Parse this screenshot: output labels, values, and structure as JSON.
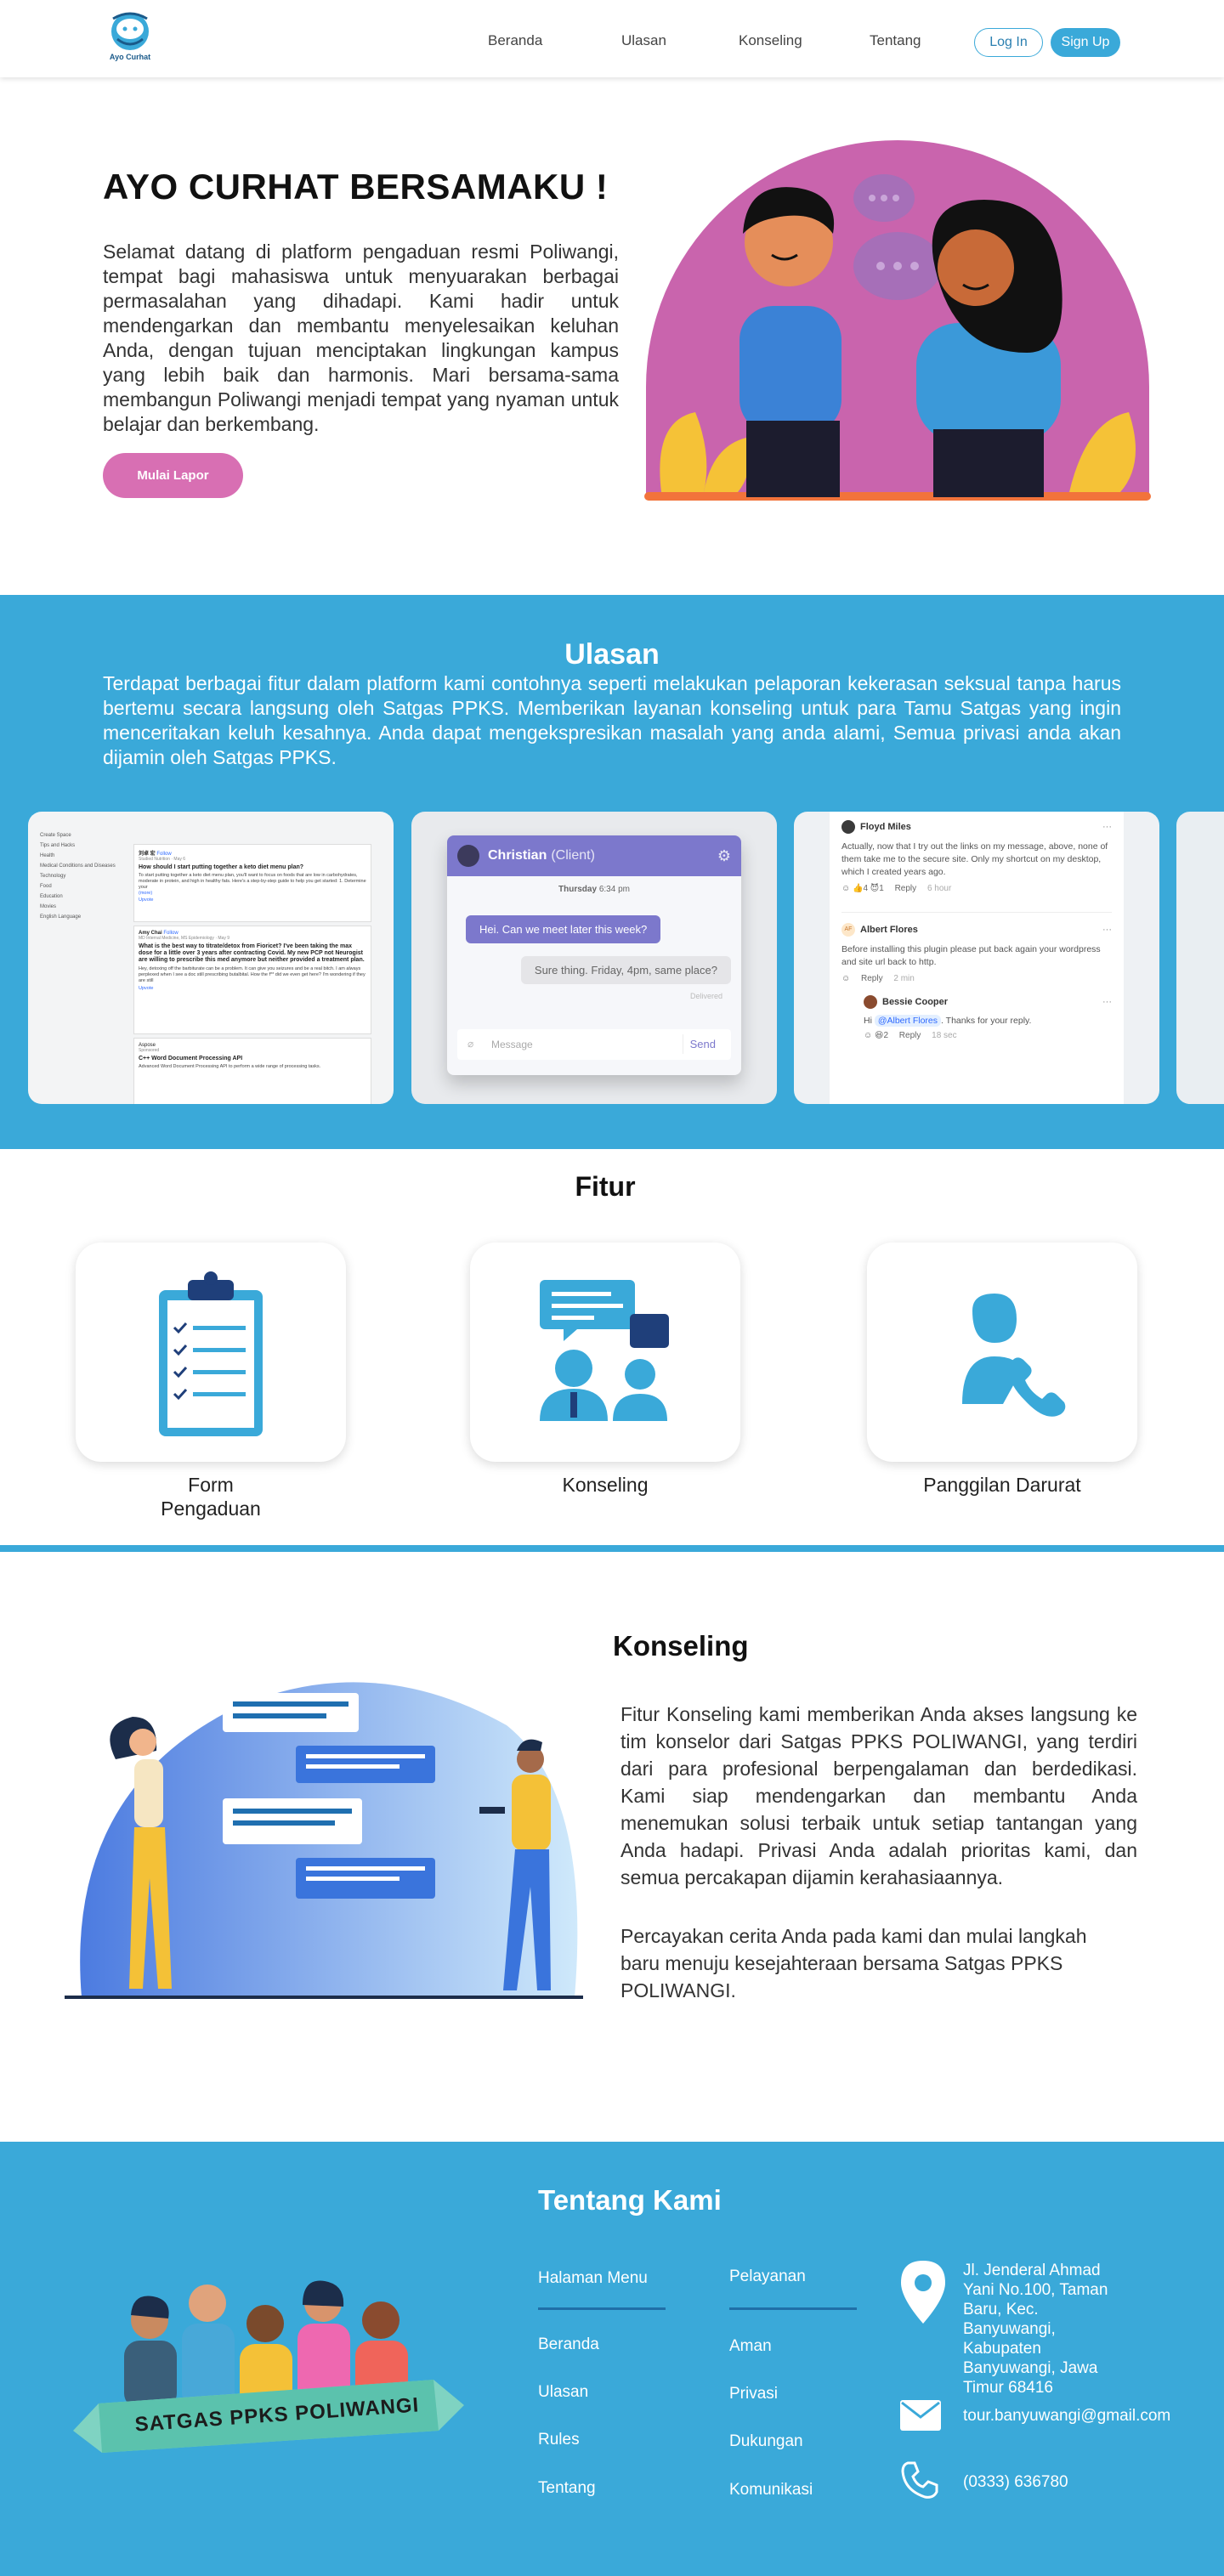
{
  "nav": {
    "logo_text": "Ayo Curhat",
    "links": [
      "Beranda",
      "Ulasan",
      "Konseling",
      "Tentang"
    ],
    "login": "Log In",
    "signup": "Sign Up"
  },
  "hero": {
    "title": "AYO CURHAT BERSAMAKU !",
    "text": "Selamat datang di platform pengaduan resmi Poliwangi, tempat bagi mahasiswa untuk menyuarakan berbagai permasalahan yang dihadapi. Kami hadir untuk mendengarkan dan membantu menyelesaikan keluhan Anda, dengan tujuan menciptakan lingkungan kampus yang lebih baik dan harmonis. Mari bersama-sama membangun Poliwangi menjadi tempat yang nyaman untuk belajar dan berkembang.",
    "button": "Mulai Lapor"
  },
  "ulasan": {
    "title": "Ulasan",
    "text": "Terdapat berbagai fitur dalam platform kami contohnya seperti melakukan pelaporan kekerasan seksual tanpa harus bertemu secara langsung oleh Satgas PPKS. Memberikan layanan konseling untuk para Tamu Satgas yang ingin menceritakan keluh kesahnya. Anda dapat mengekspresikan masalah yang anda alami, Semua privasi anda akan dijamin oleh Satgas PPKS.",
    "shot1": {
      "sidebar": [
        "Create Space",
        "Tips and Hacks",
        "Health",
        "Medical Conditions and Diseases",
        "Technology",
        "Food",
        "Education",
        "Movies",
        "English Language"
      ],
      "q1_user": "刘卓 宏",
      "q1_follow": "Follow",
      "q1_meta": "Studied Nutrition · May 6",
      "q1_title": "How should I start putting together a keto diet menu plan?",
      "q1_body": "To start putting together a keto diet menu plan, you'll want to focus on foods that are low in carbohydrates, moderate in protein, and high in healthy fats. Here's a step-by-step guide to help you get started: 1. Determine your",
      "q1_more": "(more)",
      "q1_upvote": "Upvote",
      "q2_user": "Amy Chai",
      "q2_meta": "MD Internal Medicine, MS Epidemiology · May 9",
      "q2_title": "What is the best way to titrate/detox from Fioricet? I've been taking the max dose for a little over 3 years after contracting Covid. My new PCP not Neurogist are willing to prescribe this med anymore but neither provided a treatment plan.",
      "q2_body": "Hey, detoxing off the barbiturate can be a problem. It can give you seizures and be a real bitch. I am always perplexed when I see a doc still prescribing butalbital. How the f** did we even get here? I'm wondering if they are still",
      "q3_user": "Aspose",
      "q3_meta": "Sponsored",
      "q3_title": "C++ Word Document Processing API",
      "q3_body": "Advanced Word Document Processing API to perform a wide range of processing tasks."
    },
    "shot2": {
      "name": "Christian",
      "role": "(Client)",
      "date_day": "Thursday",
      "date_time": "6:34 pm",
      "msg1": "Hei. Can we meet later this week?",
      "msg2": "Sure thing. Friday, 4pm, same place?",
      "status": "Delivered",
      "placeholder": "Message",
      "send": "Send"
    },
    "shot3": {
      "c1_name": "Floyd Miles",
      "c1_text": "Actually, now that I try out the links on my message, above, none of them take me to the secure site. Only my shortcut on my desktop, which I created years ago.",
      "c1_r1": "4",
      "c1_r2": "1",
      "reply": "Reply",
      "c1_time": "6 hour",
      "c2_initials": "AF",
      "c2_name": "Albert Flores",
      "c2_text": "Before installing this plugin please put back again your wordpress and site url back to http.",
      "c2_time": "2 min",
      "c3_name": "Bessie Cooper",
      "c3_hi": "Hi",
      "c3_mention": "@Albert Flores",
      "c3_text": ". Thanks for your reply.",
      "c3_r1": "2",
      "c3_time": "18 sec"
    }
  },
  "fitur": {
    "title": "Fitur",
    "cards": [
      {
        "label": "Form Pengaduan"
      },
      {
        "label": "Konseling"
      },
      {
        "label": "Panggilan Darurat"
      }
    ]
  },
  "konseling": {
    "title": "Konseling",
    "text1": "Fitur Konseling kami memberikan Anda akses langsung ke tim konselor dari Satgas PPKS POLIWANGI, yang terdiri dari para profesional berpengalaman dan berdedikasi. Kami siap mendengarkan dan membantu Anda menemukan solusi terbaik untuk setiap tantangan yang Anda hadapi. Privasi Anda adalah prioritas kami, dan semua percakapan dijamin kerahasiaannya.",
    "text2": "Percayakan cerita Anda pada kami dan mulai langkah baru menuju kesejahteraan bersama Satgas PPKS POLIWANGI."
  },
  "footer": {
    "title": "Tentang Kami",
    "banner_text": "SATGAS PPKS POLIWANGI",
    "menu_head": "Halaman Menu",
    "menu": [
      "Beranda",
      "Ulasan",
      "Rules",
      "Tentang"
    ],
    "service_head": "Pelayanan",
    "services": [
      "Aman",
      "Privasi",
      "Dukungan",
      "Komunikasi"
    ],
    "address": "Jl. Jenderal Ahmad Yani No.100, Taman Baru, Kec. Banyuwangi, Kabupaten Banyuwangi, Jawa Timur 68416",
    "email": "tour.banyuwangi@gmail.com",
    "phone": "(0333) 636780"
  }
}
